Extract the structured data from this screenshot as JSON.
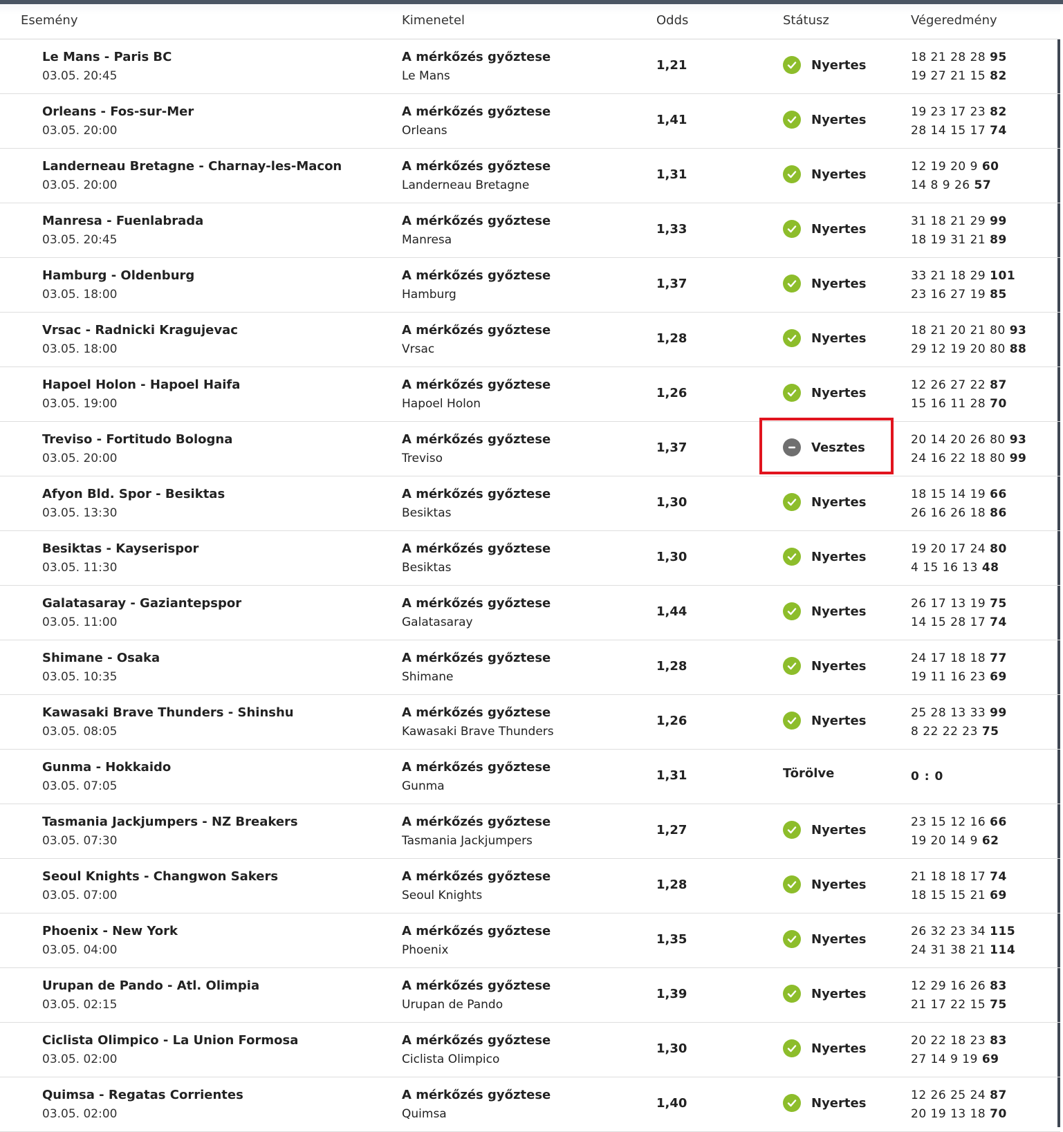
{
  "header": {
    "event": "Esemény",
    "outcome": "Kimenetel",
    "odds": "Odds",
    "status": "Státusz",
    "result": "Végeredmény"
  },
  "colors": {
    "win": "#8dbd2b",
    "loss": "#6f6f6f",
    "highlight": "#e1141e"
  },
  "rows": [
    {
      "event": "Le Mans - Paris BC",
      "date": "03.05. 20:45",
      "market": "A mérkőzés győztese",
      "pick": "Le Mans",
      "odds": "1,21",
      "status": "win",
      "status_label": "Nyertes",
      "res1": "18 21 28 28",
      "tot1": "95",
      "res2": "19 27 21 15",
      "tot2": "82"
    },
    {
      "event": "Orleans - Fos-sur-Mer",
      "date": "03.05. 20:00",
      "market": "A mérkőzés győztese",
      "pick": "Orleans",
      "odds": "1,41",
      "status": "win",
      "status_label": "Nyertes",
      "res1": "19 23 17 23",
      "tot1": "82",
      "res2": "28 14 15 17",
      "tot2": "74"
    },
    {
      "event": "Landerneau Bretagne - Charnay-les-Macon",
      "date": "03.05. 20:00",
      "market": "A mérkőzés győztese",
      "pick": "Landerneau Bretagne",
      "odds": "1,31",
      "status": "win",
      "status_label": "Nyertes",
      "res1": "12 19 20 9",
      "tot1": "60",
      "res2": "14 8 9 26",
      "tot2": "57"
    },
    {
      "event": "Manresa - Fuenlabrada",
      "date": "03.05. 20:45",
      "market": "A mérkőzés győztese",
      "pick": "Manresa",
      "odds": "1,33",
      "status": "win",
      "status_label": "Nyertes",
      "res1": "31 18 21 29",
      "tot1": "99",
      "res2": "18 19 31 21",
      "tot2": "89"
    },
    {
      "event": "Hamburg - Oldenburg",
      "date": "03.05. 18:00",
      "market": "A mérkőzés győztese",
      "pick": "Hamburg",
      "odds": "1,37",
      "status": "win",
      "status_label": "Nyertes",
      "res1": "33 21 18 29",
      "tot1": "101",
      "res2": "23 16 27 19",
      "tot2": "85"
    },
    {
      "event": "Vrsac - Radnicki Kragujevac",
      "date": "03.05. 18:00",
      "market": "A mérkőzés győztese",
      "pick": "Vrsac",
      "odds": "1,28",
      "status": "win",
      "status_label": "Nyertes",
      "res1": "18 21 20 21 80",
      "tot1": "93",
      "res2": "29 12 19 20 80",
      "tot2": "88"
    },
    {
      "event": "Hapoel Holon - Hapoel Haifa",
      "date": "03.05. 19:00",
      "market": "A mérkőzés győztese",
      "pick": "Hapoel Holon",
      "odds": "1,26",
      "status": "win",
      "status_label": "Nyertes",
      "res1": "12 26 27 22",
      "tot1": "87",
      "res2": "15 16 11 28",
      "tot2": "70"
    },
    {
      "event": "Treviso - Fortitudo Bologna",
      "date": "03.05. 20:00",
      "market": "A mérkőzés győztese",
      "pick": "Treviso",
      "odds": "1,37",
      "status": "loss",
      "status_label": "Vesztes",
      "res1": "20 14 20 26 80",
      "tot1": "93",
      "res2": "24 16 22 18 80",
      "tot2": "99"
    },
    {
      "event": "Afyon Bld. Spor - Besiktas",
      "date": "03.05. 13:30",
      "market": "A mérkőzés győztese",
      "pick": "Besiktas",
      "odds": "1,30",
      "status": "win",
      "status_label": "Nyertes",
      "res1": "18 15 14 19",
      "tot1": "66",
      "res2": "26 16 26 18",
      "tot2": "86"
    },
    {
      "event": "Besiktas - Kayserispor",
      "date": "03.05. 11:30",
      "market": "A mérkőzés győztese",
      "pick": "Besiktas",
      "odds": "1,30",
      "status": "win",
      "status_label": "Nyertes",
      "res1": "19 20 17 24",
      "tot1": "80",
      "res2": "4 15 16 13",
      "tot2": "48"
    },
    {
      "event": "Galatasaray - Gaziantepspor",
      "date": "03.05. 11:00",
      "market": "A mérkőzés győztese",
      "pick": "Galatasaray",
      "odds": "1,44",
      "status": "win",
      "status_label": "Nyertes",
      "res1": "26 17 13 19",
      "tot1": "75",
      "res2": "14 15 28 17",
      "tot2": "74"
    },
    {
      "event": "Shimane - Osaka",
      "date": "03.05. 10:35",
      "market": "A mérkőzés győztese",
      "pick": "Shimane",
      "odds": "1,28",
      "status": "win",
      "status_label": "Nyertes",
      "res1": "24 17 18 18",
      "tot1": "77",
      "res2": "19 11 16 23",
      "tot2": "69"
    },
    {
      "event": "Kawasaki Brave Thunders - Shinshu",
      "date": "03.05. 08:05",
      "market": "A mérkőzés győztese",
      "pick": "Kawasaki Brave Thunders",
      "odds": "1,26",
      "status": "win",
      "status_label": "Nyertes",
      "res1": "25 28 13 33",
      "tot1": "99",
      "res2": "8 22 22 23",
      "tot2": "75"
    },
    {
      "event": "Gunma - Hokkaido",
      "date": "03.05. 07:05",
      "market": "A mérkőzés győztese",
      "pick": "Gunma",
      "odds": "1,31",
      "status": "cancelled",
      "status_label": "Törölve",
      "score": "0 : 0"
    },
    {
      "event": "Tasmania Jackjumpers - NZ Breakers",
      "date": "03.05. 07:30",
      "market": "A mérkőzés győztese",
      "pick": "Tasmania Jackjumpers",
      "odds": "1,27",
      "status": "win",
      "status_label": "Nyertes",
      "res1": "23 15 12 16",
      "tot1": "66",
      "res2": "19 20 14 9",
      "tot2": "62"
    },
    {
      "event": "Seoul Knights - Changwon Sakers",
      "date": "03.05. 07:00",
      "market": "A mérkőzés győztese",
      "pick": "Seoul Knights",
      "odds": "1,28",
      "status": "win",
      "status_label": "Nyertes",
      "res1": "21 18 18 17",
      "tot1": "74",
      "res2": "18 15 15 21",
      "tot2": "69"
    },
    {
      "event": "Phoenix - New York",
      "date": "03.05. 04:00",
      "market": "A mérkőzés győztese",
      "pick": "Phoenix",
      "odds": "1,35",
      "status": "win",
      "status_label": "Nyertes",
      "res1": "26 32 23 34",
      "tot1": "115",
      "res2": "24 31 38 21",
      "tot2": "114"
    },
    {
      "event": "Urupan de Pando - Atl. Olimpia",
      "date": "03.05. 02:15",
      "market": "A mérkőzés győztese",
      "pick": "Urupan de Pando",
      "odds": "1,39",
      "status": "win",
      "status_label": "Nyertes",
      "res1": "12 29 16 26",
      "tot1": "83",
      "res2": "21 17 22 15",
      "tot2": "75"
    },
    {
      "event": "Ciclista Olimpico - La Union Formosa",
      "date": "03.05. 02:00",
      "market": "A mérkőzés győztese",
      "pick": "Ciclista Olimpico",
      "odds": "1,30",
      "status": "win",
      "status_label": "Nyertes",
      "res1": "20 22 18 23",
      "tot1": "83",
      "res2": "27 14 9 19",
      "tot2": "69"
    },
    {
      "event": "Quimsa - Regatas Corrientes",
      "date": "03.05. 02:00",
      "market": "A mérkőzés győztese",
      "pick": "Quimsa",
      "odds": "1,40",
      "status": "win",
      "status_label": "Nyertes",
      "res1": "12 26 25 24",
      "tot1": "87",
      "res2": "20 19 13 18",
      "tot2": "70"
    }
  ]
}
